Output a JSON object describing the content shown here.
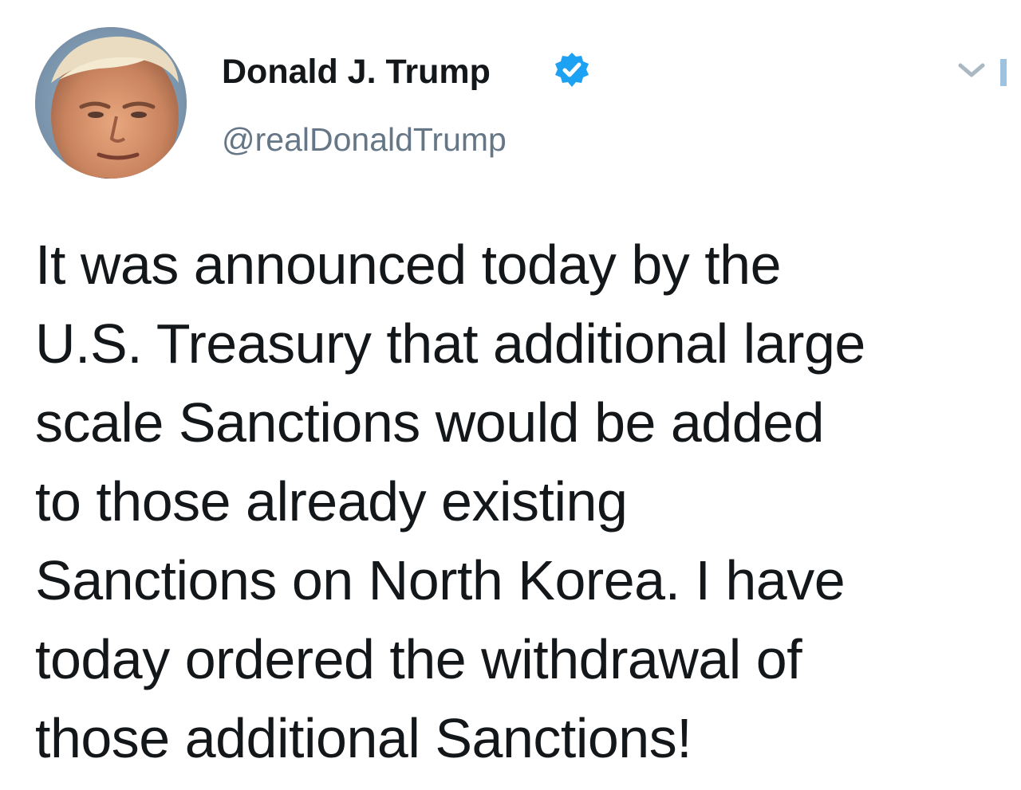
{
  "author": {
    "display_name": "Donald J. Trump",
    "handle": "@realDonaldTrump",
    "verified": true,
    "avatar_icon": "profile-photo",
    "verified_icon": "verified-badge-icon"
  },
  "menu": {
    "icon": "chevron-down-icon"
  },
  "tweet": {
    "lines": [
      "It was announced today by the",
      "U.S. Treasury that additional large",
      "scale Sanctions would be added",
      "to those already existing",
      "Sanctions on North Korea. I have",
      "today ordered the withdrawal of",
      "those additional Sanctions!"
    ]
  },
  "colors": {
    "text": "#14171a",
    "secondary": "#657786",
    "verified_blue": "#1da1f2",
    "caret": "#aab8c2"
  }
}
